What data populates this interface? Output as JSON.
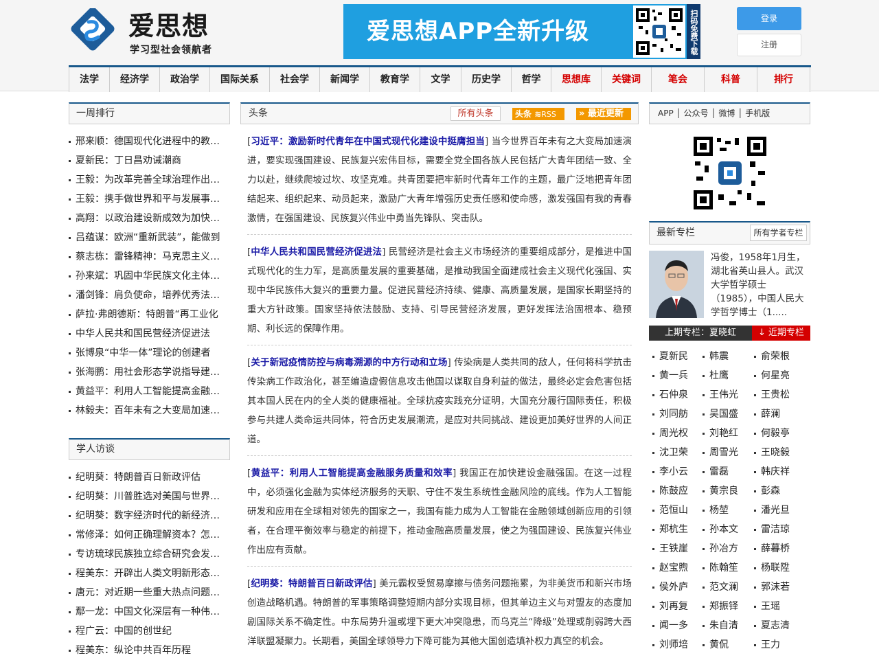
{
  "header": {
    "logo_name": "爱思想",
    "logo_slogan": "学习型社会领航者",
    "banner_text": "爱思想APP全新升级",
    "banner_scan": "扫码免费下载",
    "login": "登录",
    "register": "注册"
  },
  "nav": [
    {
      "label": "法学",
      "red": false
    },
    {
      "label": "经济学",
      "red": false
    },
    {
      "label": "政治学",
      "red": false
    },
    {
      "label": "国际关系",
      "red": false
    },
    {
      "label": "社会学",
      "red": false
    },
    {
      "label": "新闻学",
      "red": false
    },
    {
      "label": "教育学",
      "red": false
    },
    {
      "label": "文学",
      "red": false
    },
    {
      "label": "历史学",
      "red": false
    },
    {
      "label": "哲学",
      "red": false
    },
    {
      "label": "思想库",
      "red": true
    },
    {
      "label": "关键词",
      "red": true
    },
    {
      "label": "笔会",
      "red": true
    },
    {
      "label": "科普",
      "red": true
    },
    {
      "label": "排行",
      "red": true
    }
  ],
  "weekly": {
    "title": "一周排行",
    "items": [
      "邢来顺：德国现代化进程中的教…",
      "夏新民：丁日昌劝诫潮商",
      "王毅：为改革完善全球治理作出…",
      "王毅：携手做世界和平与发展事…",
      "高翔：以政治建设新成效为加快…",
      "吕蕴谋：欧洲“重新武装”，能做到",
      "蔡志栋：雷锋精神：马克思主义…",
      "孙来斌：巩固中华民族文化主体…",
      "潘剑锋：肩负使命，培养优秀法…",
      "萨拉·弗朗德斯：特朗普“再工业化",
      "中华人民共和国民营经济促进法",
      "张博泉“中华一体”理论的创建者",
      "张海鹏：用社会形态学说指导建…",
      "黄益平：利用人工智能提高金融…",
      "林毅夫：百年未有之大变局加速…"
    ]
  },
  "interviews": {
    "title": "学人访谈",
    "items": [
      "纪明葵：特朗普百日新政评估",
      "纪明葵：川普胜选对美国与世界…",
      "纪明葵：数字经济时代的新经济…",
      "常修泽：如何正确理解资本？怎…",
      "专访琉球民族独立综合研究会发…",
      "程美东：开辟出人类文明新形态…",
      "唐元：对近期一些重大热点问题…",
      "鄢一龙：中国文化深层有一种伟…",
      "程广云：中国的创世纪",
      "程美东：纵论中共百年历程"
    ]
  },
  "headlines": {
    "title": "头条",
    "all": "所有头条",
    "rss_label": "头条",
    "rss_small": "RSS",
    "latest": "最近更新",
    "articles": [
      {
        "title": "习近平：激励新时代青年在中国式现代化建设中挺膺担当",
        "body": "当今世界百年未有之大变局加速演进，要实现强国建设、民族复兴宏伟目标，需要全党全国各族人民包括广大青年团结一致、全力以赴，继续爬坡过坎、攻坚克难。共青团要把牢新时代青年工作的主题，最广泛地把青年团结起来、组织起来、动员起来，激励广大青年增强历史责任感和使命感，激发强国有我的青春激情，在强国建设、民族复兴伟业中勇当先锋队、突击队。"
      },
      {
        "title": "中华人民共和国民营经济促进法",
        "body": "民营经济是社会主义市场经济的重要组成部分，是推进中国式现代化的生力军，是高质量发展的重要基础，是推动我国全面建成社会主义现代化强国、实现中华民族伟大复兴的重要力量。促进民营经济持续、健康、高质量发展，是国家长期坚持的重大方针政策。国家坚持依法鼓励、支持、引导民营经济发展，更好发挥法治固根本、稳预期、利长远的保障作用。"
      },
      {
        "title": "关于新冠疫情防控与病毒溯源的中方行动和立场",
        "body": "传染病是人类共同的敌人，任何将科学抗击传染病工作政治化，甚至编造虚假信息攻击他国以谋取自身利益的做法，最终必定会危害包括其本国人民在内的全人类的健康福祉。全球抗疫实践充分证明，大国充分履行国际责任，积极参与共建人类命运共同体，符合历史发展潮流，是应对共同挑战、建设更加美好世界的人间正道。"
      },
      {
        "title": "黄益平：利用人工智能提高金融服务质量和效率",
        "body": "我国正在加快建设金融强国。在这一过程中，必须强化金融为实体经济服务的天职、守住不发生系统性金融风险的底线。作为人工智能研发和应用在全球相对领先的国家之一，我国有能力成为人工智能在金融领域创新应用的引领者，在合理平衡效率与稳定的前提下，推动金融高质量发展，使之为强国建设、民族复兴伟业作出应有贡献。"
      },
      {
        "title": "纪明葵：特朗普百日新政评估",
        "body": "美元霸权受贸易摩擦与债务问题拖累，为非美货币和新兴市场创造战略机遇。特朗普的军事策略调整短期内部分实现目标，但其单边主义与对盟友的态度加剧国际关系不确定性。中东局势升温或埋下更大冲突隐患，而乌克兰“降级”处理或削弱跨大西洋联盟凝聚力。长期看，美国全球领导力下降可能为其他大国创造填补权力真空的机会。"
      }
    ]
  },
  "right": {
    "links": "APP │ 公众号 │ 微博 │ 手机版",
    "column_title": "最新专栏",
    "all_scholars": "所有学者专栏",
    "bio": "冯俊，1958年1月生，湖北省英山县人。武汉大学哲学硕士（1985），中国人民大学哲学博士（1.....",
    "prev": "上期专栏：夏晓虹",
    "recent": "↓ 近期专栏",
    "names": [
      "夏新民",
      "韩震",
      "俞荣根",
      "黄一兵",
      "杜鹰",
      "何星亮",
      "石仲泉",
      "王伟光",
      "王贵松",
      "刘同舫",
      "吴国盛",
      "薛澜",
      "周光权",
      "刘艳红",
      "何毅亭",
      "沈卫荣",
      "周雪光",
      "王晓毅",
      "李小云",
      "雷磊",
      "韩庆祥",
      "陈鼓应",
      "黄宗良",
      "彭森",
      "范恒山",
      "杨堃",
      "潘光旦",
      "郑杭生",
      "孙本文",
      "雷洁琼",
      "王铁崖",
      "孙冶方",
      "薛暮桥",
      "赵宝煦",
      "陈翰笙",
      "杨联陞",
      "侯外庐",
      "范文澜",
      "郭沫若",
      "刘再复",
      "郑振铎",
      "王瑶",
      "闻一多",
      "朱自清",
      "夏志清",
      "刘师培",
      "黄侃",
      "王力"
    ]
  },
  "colors": {
    "nav_border": "#18588a",
    "accent_red": "#d40000",
    "orange": "#f39800",
    "link_blue": "#1a1aa6",
    "banner_blue": "#1f9fe0"
  }
}
